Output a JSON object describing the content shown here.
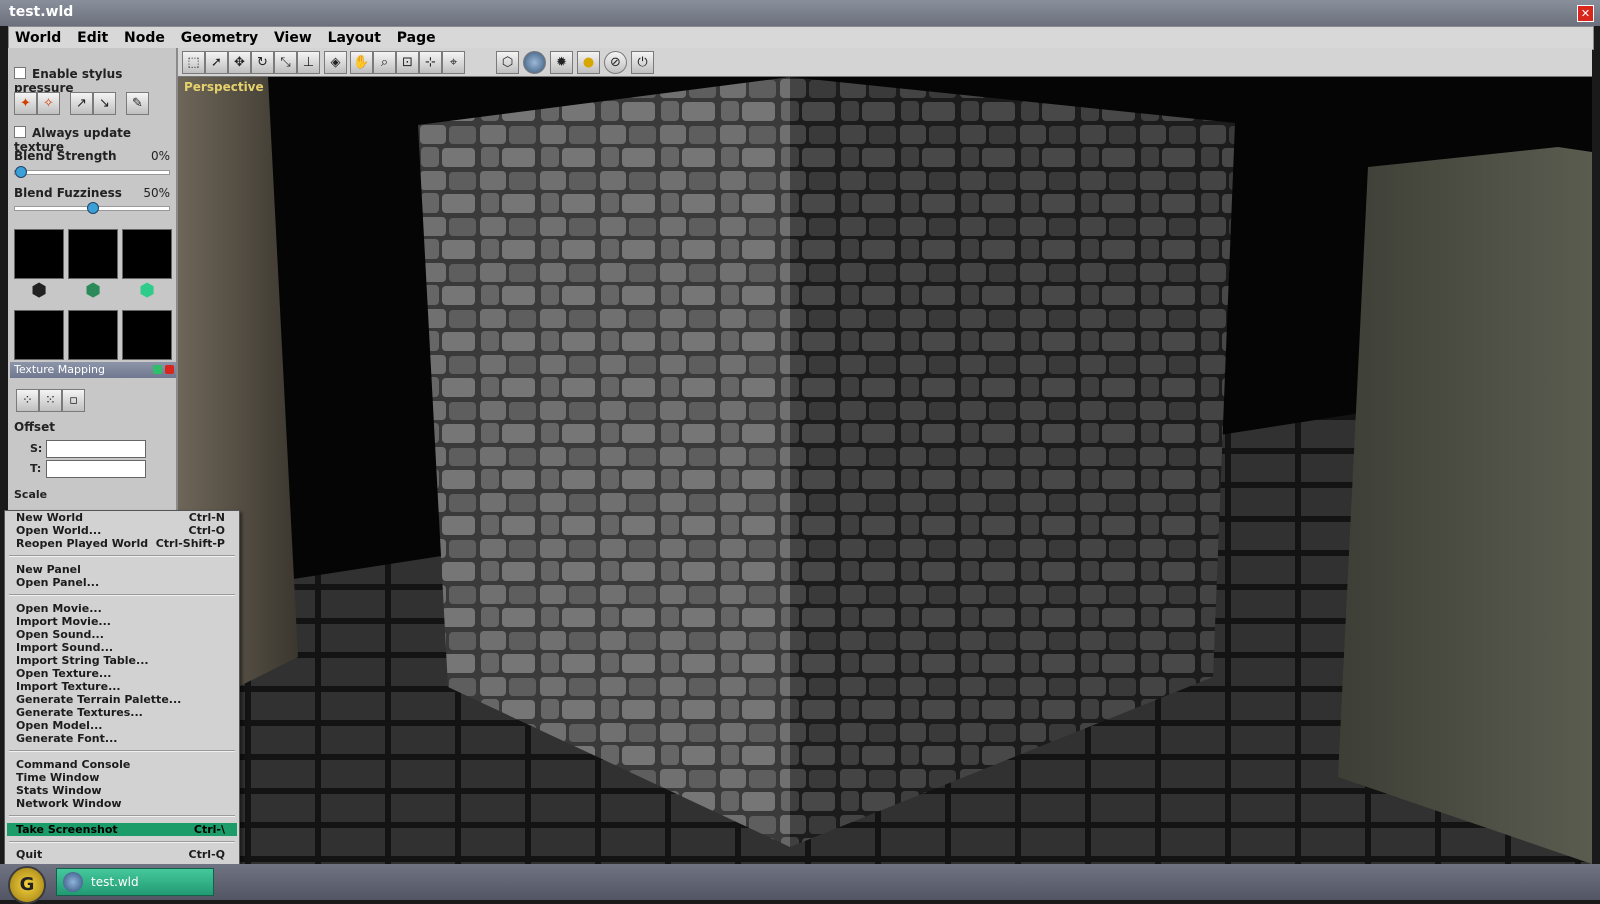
{
  "window": {
    "title": "test.wld"
  },
  "menubar": {
    "items": [
      "World",
      "Edit",
      "Node",
      "Geometry",
      "View",
      "Layout",
      "Page"
    ]
  },
  "toolbar": {
    "tools": [
      "select-tool",
      "arrow-tool",
      "move-tool",
      "rotate-tool",
      "scale-tool",
      "pivot-tool",
      "node-tool",
      "pan-tool",
      "zoom-tool",
      "zoom-box-tool",
      "orbit-tool",
      "center-tool"
    ],
    "view_tools": [
      "wireframe-view",
      "globe-view",
      "light-view",
      "bulb-view",
      "grid-view",
      "time-view"
    ]
  },
  "left_panel": {
    "stylus_label": "Enable stylus pressure",
    "always_update_label": "Always update texture",
    "blend_strength": {
      "label": "Blend Strength",
      "value_text": "0%",
      "value": 0.0
    },
    "blend_fuzziness": {
      "label": "Blend Fuzziness",
      "value_text": "50%",
      "value": 0.5
    }
  },
  "texture_mapping": {
    "title": "Texture Mapping",
    "offset_label": "Offset",
    "s_label": "S:",
    "t_label": "T:",
    "scale_label": "Scale"
  },
  "viewport": {
    "label": "Perspective"
  },
  "world_menu": {
    "items": [
      {
        "label": "New World",
        "shortcut": "Ctrl-N"
      },
      {
        "label": "Open World...",
        "shortcut": "Ctrl-O"
      },
      {
        "label": "Reopen Played World",
        "shortcut": "Ctrl-Shift-P"
      },
      {
        "label": "New Panel",
        "shortcut": ""
      },
      {
        "label": "Open Panel...",
        "shortcut": ""
      },
      {
        "label": "Open Movie...",
        "shortcut": ""
      },
      {
        "label": "Import Movie...",
        "shortcut": ""
      },
      {
        "label": "Open Sound...",
        "shortcut": ""
      },
      {
        "label": "Import Sound...",
        "shortcut": ""
      },
      {
        "label": "Import String Table...",
        "shortcut": ""
      },
      {
        "label": "Open Texture...",
        "shortcut": ""
      },
      {
        "label": "Import Texture...",
        "shortcut": ""
      },
      {
        "label": "Generate Terrain Palette...",
        "shortcut": ""
      },
      {
        "label": "Generate Textures...",
        "shortcut": ""
      },
      {
        "label": "Open Model...",
        "shortcut": ""
      },
      {
        "label": "Generate Font...",
        "shortcut": ""
      },
      {
        "label": "Command Console",
        "shortcut": ""
      },
      {
        "label": "Time Window",
        "shortcut": ""
      },
      {
        "label": "Stats Window",
        "shortcut": ""
      },
      {
        "label": "Network Window",
        "shortcut": ""
      },
      {
        "label": "Take Screenshot",
        "shortcut": "Ctrl-\\"
      },
      {
        "label": "Quit",
        "shortcut": "Ctrl-Q"
      }
    ]
  },
  "taskbar": {
    "start_icon": "start-orb-icon",
    "task_label": "test.wld"
  },
  "colors": {
    "accent_green": "#1c9c68",
    "title_gradient": "#7a7f8c",
    "viewport_label": "#e6d26c"
  }
}
